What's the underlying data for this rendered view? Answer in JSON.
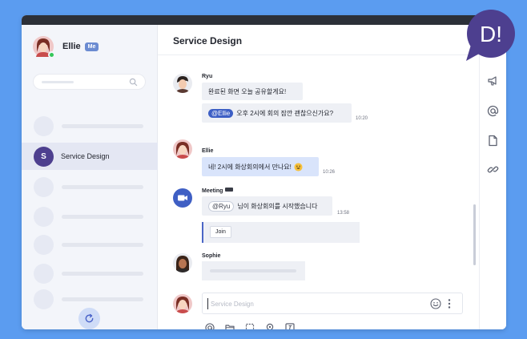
{
  "app": {
    "accent": "#5b9cf0",
    "brand": "#4d3f8f"
  },
  "profile": {
    "name": "Ellie",
    "badge": "Me",
    "status": "online"
  },
  "sidebar": {
    "search_icon": "search-icon",
    "active_channel": {
      "initial": "S",
      "label": "Service Design"
    },
    "refresh_icon": "refresh-icon"
  },
  "main": {
    "title": "Service Design"
  },
  "messages": [
    {
      "sender": "Ryu",
      "lines": [
        "완료된 화면 오늘 공유할게요!"
      ],
      "mention": "@Ellie",
      "mention_text": "오후 2시에 회의 잠깐 괜찮으신가요?",
      "time": "10:20"
    },
    {
      "sender": "Ellie",
      "text": "네! 2시에 화상회의에서 만나요!",
      "emoji": "smiling-face",
      "time": "10:26"
    },
    {
      "sender": "Meeting",
      "mention": "@Ryu",
      "mention_text": "님이 화상회의를 시작했습니다",
      "time": "13:58",
      "button": "Join"
    },
    {
      "sender": "Sophie"
    }
  ],
  "composer": {
    "placeholder": "Service Design",
    "emoji_icon": "emoji-icon",
    "more_icon": "more-vertical-icon"
  },
  "toolbar": [
    "at-icon",
    "folder-icon",
    "screenshot-icon",
    "camera-icon",
    "format-icon"
  ],
  "rail": [
    "megaphone-icon",
    "at-icon",
    "document-icon",
    "link-icon"
  ],
  "logo": {
    "text": "D!"
  }
}
